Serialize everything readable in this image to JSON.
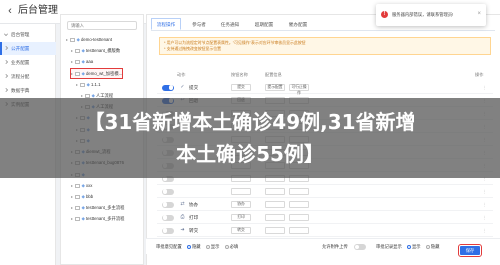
{
  "header": {
    "back_glyph": "‹",
    "title": "后台管理"
  },
  "leftnav": {
    "items": [
      {
        "label": "后台管理",
        "active": false,
        "expanded": true
      },
      {
        "label": "公开配置",
        "active": true,
        "expanded": false
      },
      {
        "label": "业务配置",
        "active": false,
        "expanded": false
      },
      {
        "label": "流程分配",
        "active": false,
        "expanded": false
      },
      {
        "label": "数据字典",
        "active": false,
        "expanded": false
      },
      {
        "label": "实例配置",
        "active": false,
        "expanded": false
      }
    ]
  },
  "tree": {
    "search_placeholder": "请输入",
    "rows": [
      {
        "label": "demo-testtenant",
        "level": 0,
        "selected": false
      },
      {
        "label": "testtenant_模版数",
        "level": 1,
        "selected": false
      },
      {
        "label": "aaa",
        "level": 1,
        "selected": false
      },
      {
        "label": "demo_wt_加密模...",
        "level": 1,
        "selected": true
      },
      {
        "label": "1.1.1",
        "level": 2,
        "selected": false
      },
      {
        "label": "人工流程",
        "level": 3,
        "selected": false
      },
      {
        "label": "人工流程",
        "level": 3,
        "selected": false
      },
      {
        "label": "",
        "level": 2,
        "selected": false
      },
      {
        "label": "",
        "level": 2,
        "selected": false
      },
      {
        "label": "",
        "level": 2,
        "selected": false
      },
      {
        "label": "diemwt_流程",
        "level": 1,
        "selected": false
      },
      {
        "label": "testtenant_bug0876",
        "level": 1,
        "selected": false
      },
      {
        "label": "",
        "level": 1,
        "selected": false
      },
      {
        "label": "xxx",
        "level": 1,
        "selected": false
      },
      {
        "label": "bbb",
        "level": 1,
        "selected": false
      },
      {
        "label": "testtenant_多主流程",
        "level": 1,
        "selected": false
      },
      {
        "label": "testtenant_多开流程",
        "level": 1,
        "selected": false
      }
    ]
  },
  "main": {
    "tabs": [
      "流程操作",
      "参与者",
      "任务通知",
      "超期配置",
      "催办配置"
    ],
    "notice_lines": [
      "* 用户可以为流程定时节点配置表属性。\"可见操作\"表示对应环节审核员显示此按钮",
      "* 支持通过拖拽改变按钮显示位置"
    ],
    "columns": [
      "动作",
      "按钮名称",
      "配置信息",
      "操作"
    ],
    "rows": [
      {
        "name": "提交",
        "icon": "submit-icon",
        "glyph": "✓",
        "on": true,
        "btn_text": "提交",
        "inputs": [
          "提示配置",
          "可行止操作"
        ]
      },
      {
        "name": "回退",
        "icon": "return-icon",
        "glyph": "↩",
        "on": true,
        "btn_text": "回退",
        "inputs": [
          "",
          ""
        ]
      },
      {
        "name": "",
        "icon": "blank-icon",
        "glyph": "",
        "on": false,
        "btn_text": "",
        "inputs": [
          "",
          ""
        ]
      },
      {
        "name": "",
        "icon": "blank-icon",
        "glyph": "",
        "on": false,
        "btn_text": "",
        "inputs": [
          "",
          ""
        ]
      },
      {
        "name": "",
        "icon": "blank-icon",
        "glyph": "",
        "on": false,
        "btn_text": "",
        "inputs": [
          "",
          ""
        ]
      },
      {
        "name": "",
        "icon": "blank-icon",
        "glyph": "",
        "on": false,
        "btn_text": "",
        "inputs": [
          "",
          ""
        ]
      },
      {
        "name": "",
        "icon": "blank-icon",
        "glyph": "",
        "on": false,
        "btn_text": "",
        "inputs": [
          "",
          ""
        ]
      },
      {
        "name": "",
        "icon": "blank-icon",
        "glyph": "",
        "on": false,
        "btn_text": "",
        "inputs": [
          "",
          ""
        ]
      },
      {
        "name": "",
        "icon": "blank-icon",
        "glyph": "",
        "on": false,
        "btn_text": "",
        "inputs": [
          "",
          ""
        ]
      },
      {
        "name": "协办",
        "icon": "assist-icon",
        "glyph": "⇄",
        "on": false,
        "btn_text": "协办",
        "inputs": [
          "",
          ""
        ]
      },
      {
        "name": "打印",
        "icon": "print-icon",
        "glyph": "⎙",
        "on": false,
        "btn_text": "打印",
        "inputs": [
          "",
          ""
        ]
      },
      {
        "name": "转交",
        "icon": "transfer-icon",
        "glyph": "➜",
        "on": false,
        "btn_text": "转交",
        "inputs": [
          "",
          ""
        ]
      },
      {
        "name": "",
        "icon": "blank-icon",
        "glyph": "",
        "on": false,
        "btn_text": "",
        "inputs": [
          "",
          ""
        ]
      }
    ],
    "footer": {
      "approval_label": "审批意见配置",
      "approval_options": [
        "隐藏",
        "显示",
        "必填"
      ],
      "upload_label": "允许附件上传",
      "record_label": "审批记录显示",
      "record_options": [
        "显示",
        "隐藏"
      ]
    },
    "save_label": "保存"
  },
  "toast": {
    "icon_glyph": "!",
    "message": "服务器内部错误，请联系管理员!",
    "close_glyph": "×"
  },
  "watermark": {
    "line1": "【31省新增本土确诊49例,31省新增",
    "line2": "本土确诊55例】"
  }
}
